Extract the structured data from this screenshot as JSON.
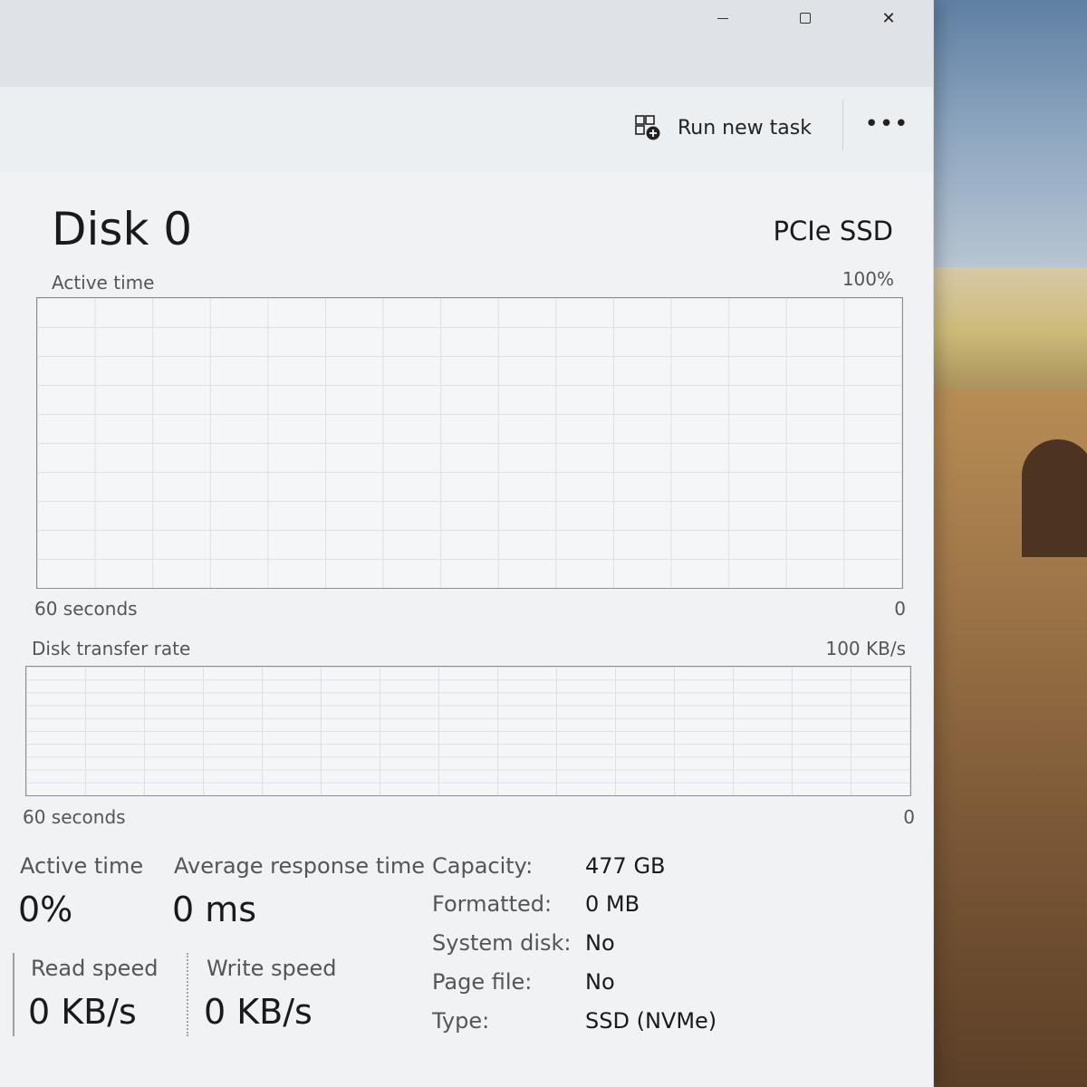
{
  "window": {
    "controls": {
      "minimize_icon": "minimize-icon",
      "maximize_icon": "maximize-icon",
      "close_icon": "close-icon",
      "close_glyph": "✕"
    },
    "toolbar": {
      "run_new_task_label": "Run new task",
      "more_glyph": "•••"
    }
  },
  "disk": {
    "title": "Disk 0",
    "type": "PCIe SSD",
    "active_time_graph": {
      "label": "Active time",
      "max_label": "100%",
      "time_label": "60 seconds",
      "min_label": "0"
    },
    "transfer_graph": {
      "label": "Disk transfer rate",
      "max_label": "100 KB/s",
      "time_label": "60 seconds",
      "min_label": "0"
    },
    "stats": {
      "active_time_label": "Active time",
      "active_time_value": "0%",
      "avg_response_label": "Average response time",
      "avg_response_value": "0 ms",
      "read_speed_label": "Read speed",
      "read_speed_value": "0 KB/s",
      "write_speed_label": "Write speed",
      "write_speed_value": "0 KB/s"
    },
    "properties": [
      {
        "label": "Capacity:",
        "value": "477 GB"
      },
      {
        "label": "Formatted:",
        "value": "0 MB"
      },
      {
        "label": "System disk:",
        "value": "No"
      },
      {
        "label": "Page file:",
        "value": "No"
      },
      {
        "label": "Type:",
        "value": "SSD (NVMe)"
      }
    ]
  }
}
